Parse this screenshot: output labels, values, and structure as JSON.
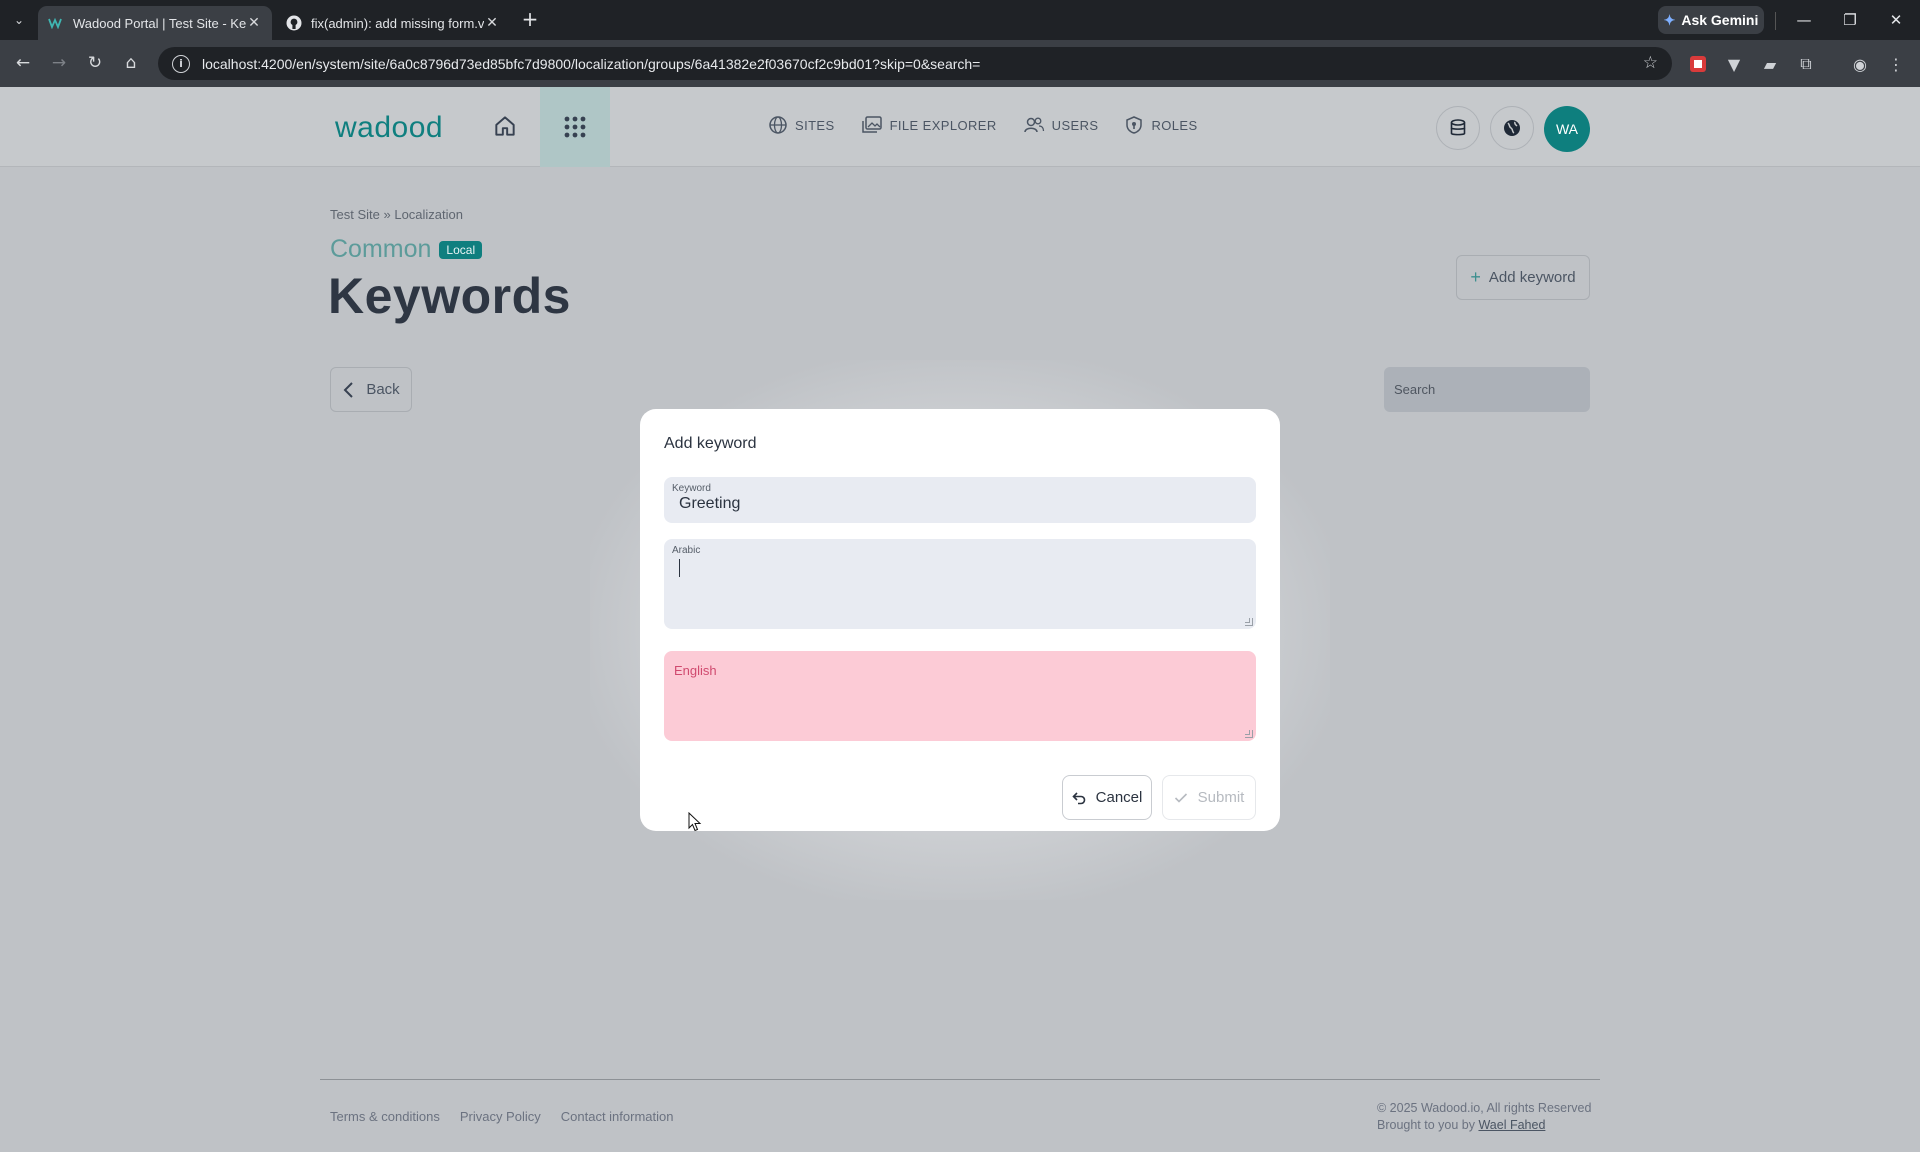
{
  "browser": {
    "tabs": [
      {
        "title": "Wadood Portal | Test Site - Keywords",
        "active": true
      },
      {
        "title": "fix(admin): add missing form.value",
        "active": false
      }
    ],
    "gemini_label": "Ask Gemini",
    "url": "localhost:4200/en/system/site/6a0c8796d73ed85bfc7d9800/localization/groups/6a41382e2f03670cf2c9bd01?skip=0&search="
  },
  "header": {
    "logo": "wadood",
    "nav": [
      {
        "label": "SITES",
        "icon": "globe-icon"
      },
      {
        "label": "FILE EXPLORER",
        "icon": "images-icon"
      },
      {
        "label": "USERS",
        "icon": "users-icon"
      },
      {
        "label": "ROLES",
        "icon": "shield-icon"
      }
    ],
    "avatar_initials": "WA"
  },
  "breadcrumb": {
    "site": "Test Site",
    "separator": "»",
    "section": "Localization"
  },
  "section": {
    "title": "Common",
    "badge": "Local"
  },
  "page_title": "Keywords",
  "actions": {
    "add_keyword": "Add keyword",
    "back": "Back",
    "search_placeholder": "Search"
  },
  "modal": {
    "title": "Add keyword",
    "fields": {
      "keyword": {
        "label": "Keyword",
        "value": "Greeting"
      },
      "arabic": {
        "label": "Arabic",
        "value": ""
      },
      "english": {
        "label": "English",
        "value": ""
      }
    },
    "cancel": "Cancel",
    "submit": "Submit"
  },
  "footer": {
    "links": [
      "Terms & conditions",
      "Privacy Policy",
      "Contact information"
    ],
    "copyright": "© 2025 Wadood.io, All rights Reserved",
    "brought_by": "Brought to you by",
    "author": "Wael Fahed"
  },
  "colors": {
    "brand": "#0f7f7f",
    "error_fill": "#fccbd6",
    "error_text": "#d04a6f"
  }
}
